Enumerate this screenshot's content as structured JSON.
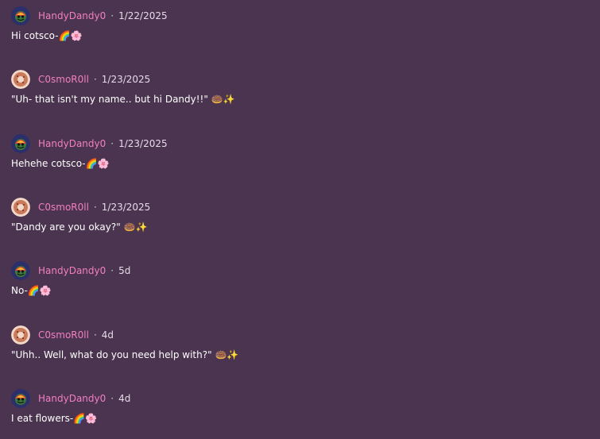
{
  "comments": [
    {
      "username": "HandyDandy0",
      "separator": "·",
      "date": "1/22/2025",
      "text": "Hi cotsco-🌈🌸",
      "avatar_icon": "handydandy-avatar"
    },
    {
      "username": "C0smoR0ll",
      "separator": "·",
      "date": "1/23/2025",
      "text": "\"Uh- that isn't my name.. but hi Dandy!!\" 🍩✨",
      "avatar_icon": "cosmoroll-avatar"
    },
    {
      "username": "HandyDandy0",
      "separator": "·",
      "date": "1/23/2025",
      "text": "Hehehe cotsco-🌈🌸",
      "avatar_icon": "handydandy-avatar"
    },
    {
      "username": "C0smoR0ll",
      "separator": "·",
      "date": "1/23/2025",
      "text": "\"Dandy are you okay?\" 🍩✨",
      "avatar_icon": "cosmoroll-avatar"
    },
    {
      "username": "HandyDandy0",
      "separator": "·",
      "date": "5d",
      "text": "No-🌈🌸",
      "avatar_icon": "handydandy-avatar"
    },
    {
      "username": "C0smoR0ll",
      "separator": "·",
      "date": "4d",
      "text": "\"Uhh.. Well, what do you need help with?\" 🍩✨",
      "avatar_icon": "cosmoroll-avatar"
    },
    {
      "username": "HandyDandy0",
      "separator": "·",
      "date": "4d",
      "text": "I eat flowers-🌈🌸",
      "avatar_icon": "handydandy-avatar"
    }
  ],
  "colors": {
    "background": "#4b3450",
    "username": "#f27fc3",
    "text": "#ffffff"
  }
}
